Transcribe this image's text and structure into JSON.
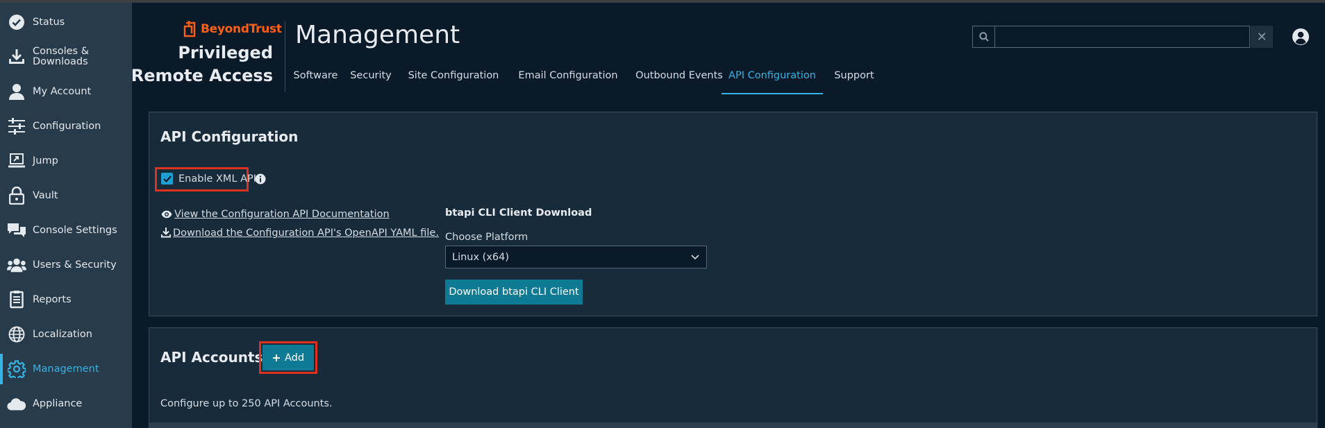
{
  "sidebar": {
    "items": [
      {
        "label": "Status",
        "icon": "check-circle-icon"
      },
      {
        "label": "Consoles &\nDownloads",
        "icon": "download-icon"
      },
      {
        "label": "My Account",
        "icon": "user-icon"
      },
      {
        "label": "Configuration",
        "icon": "sliders-icon"
      },
      {
        "label": "Jump",
        "icon": "jump-icon"
      },
      {
        "label": "Vault",
        "icon": "lock-icon"
      },
      {
        "label": "Console Settings",
        "icon": "chat-icon"
      },
      {
        "label": "Users & Security",
        "icon": "users-icon"
      },
      {
        "label": "Reports",
        "icon": "report-icon"
      },
      {
        "label": "Localization",
        "icon": "globe-icon"
      },
      {
        "label": "Management",
        "icon": "gear-icon"
      },
      {
        "label": "Appliance",
        "icon": "cloud-icon"
      }
    ],
    "active_index": 10
  },
  "header": {
    "brand": "BeyondTrust",
    "product_line1": "Privileged",
    "product_line2": "Remote Access",
    "title": "Management",
    "tabs": [
      {
        "label": "Software"
      },
      {
        "label": "Security"
      },
      {
        "label": "Site Configuration"
      },
      {
        "label": "Email Configuration"
      },
      {
        "label": "Outbound Events"
      },
      {
        "label": "API Configuration"
      },
      {
        "label": "Support"
      }
    ],
    "active_tab": "API Configuration",
    "search_value": "",
    "clear_symbol": "✕"
  },
  "api_config": {
    "title": "API Configuration",
    "enable_xml_label": "Enable XML API",
    "enable_xml_checked": true,
    "link_docs": "View the Configuration API Documentation",
    "link_yaml": "Download the Configuration API's OpenAPI YAML file.",
    "cli_heading": "btapi CLI Client Download",
    "platform_label": "Choose Platform",
    "platform_value": "Linux (x64)",
    "download_button": "Download btapi CLI Client"
  },
  "api_accounts": {
    "title": "API Accounts",
    "add_button": "Add",
    "description": "Configure up to 250 API Accounts."
  },
  "colors": {
    "accent": "#36b4e5",
    "brand": "#ff5f14",
    "button": "#0f7a93",
    "highlight": "#e0301e"
  }
}
